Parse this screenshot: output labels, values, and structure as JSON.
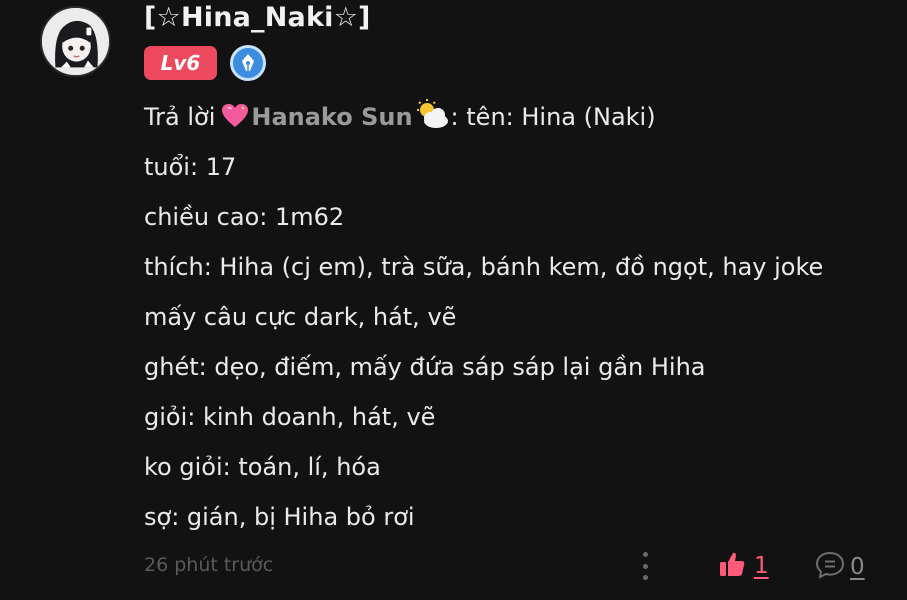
{
  "comment": {
    "username": "[☆Hina_Naki☆]",
    "level_badge": "Lv6",
    "title_badge_icon": "pen-nib-icon",
    "reply_prefix": "Trả lời",
    "mention_name": "Hanako Sun",
    "first_line_rest": ": tên: Hina (Naki)",
    "lines": [
      "tuổi: 17",
      "chiều cao: 1m62",
      "thích: Hiha (cj em), trà sữa, bánh kem, đồ ngọt, hay joke",
      "mấy câu cực dark, hát, vẽ",
      "ghét: dẹo, điếm, mấy đứa sáp sáp lại gần Hiha",
      "giỏi: kinh doanh, hát, vẽ",
      "ko giỏi: toán, lí, hóa",
      "sợ: gián, bị Hiha bỏ rơi"
    ],
    "timestamp": "26 phút trước",
    "like_count": "1",
    "reply_count": "0"
  },
  "colors": {
    "background": "#121212",
    "level_badge": "#ee4a5f",
    "like_accent": "#ff5a7a",
    "title_badge": "#3c8de0",
    "mention": "#9a9a9a"
  }
}
